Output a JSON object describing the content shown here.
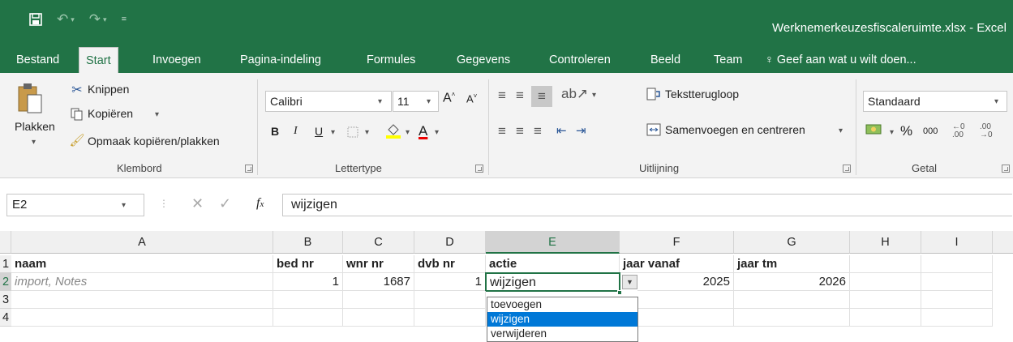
{
  "window": {
    "title": "Werknemerkeuzesfiscaleruimte.xlsx - Excel"
  },
  "tabs": [
    "Bestand",
    "Start",
    "Invoegen",
    "Pagina-indeling",
    "Formules",
    "Gegevens",
    "Controleren",
    "Beeld",
    "Team"
  ],
  "tell_me": "Geef aan wat u wilt doen...",
  "clipboard": {
    "paste": "Plakken",
    "cut": "Knippen",
    "copy": "Kopiëren",
    "format_painter": "Opmaak kopiëren/plakken",
    "label": "Klembord"
  },
  "font": {
    "name": "Calibri",
    "size": "11",
    "bold": "B",
    "italic": "I",
    "underline": "U",
    "font_color": "A",
    "label": "Lettertype"
  },
  "alignment": {
    "wrap": "Tekstterugloop",
    "merge": "Samenvoegen en centreren",
    "label": "Uitlijning"
  },
  "number": {
    "format": "Standaard",
    "percent": "%",
    "thousands": "000",
    "label": "Getal"
  },
  "formula_bar": {
    "cell_ref": "E2",
    "content": "wijzigen",
    "fx": "fx"
  },
  "columns": [
    "A",
    "B",
    "C",
    "D",
    "E",
    "F",
    "G",
    "H",
    "I"
  ],
  "rows": [
    "1",
    "2",
    "3",
    "4"
  ],
  "headers": [
    "naam",
    "bed nr",
    "wnr nr",
    "dvb nr",
    "actie",
    "jaar vanaf",
    "jaar tm"
  ],
  "row2": [
    "import, Notes",
    "1",
    "1687",
    "1",
    "wijzigen",
    "2025",
    "2026"
  ],
  "dropdown": {
    "options": [
      "toevoegen",
      "wijzigen",
      "verwijderen"
    ],
    "selected": "wijzigen"
  },
  "colors": {
    "excel_green": "#217346",
    "selection_blue": "#0078d7"
  }
}
